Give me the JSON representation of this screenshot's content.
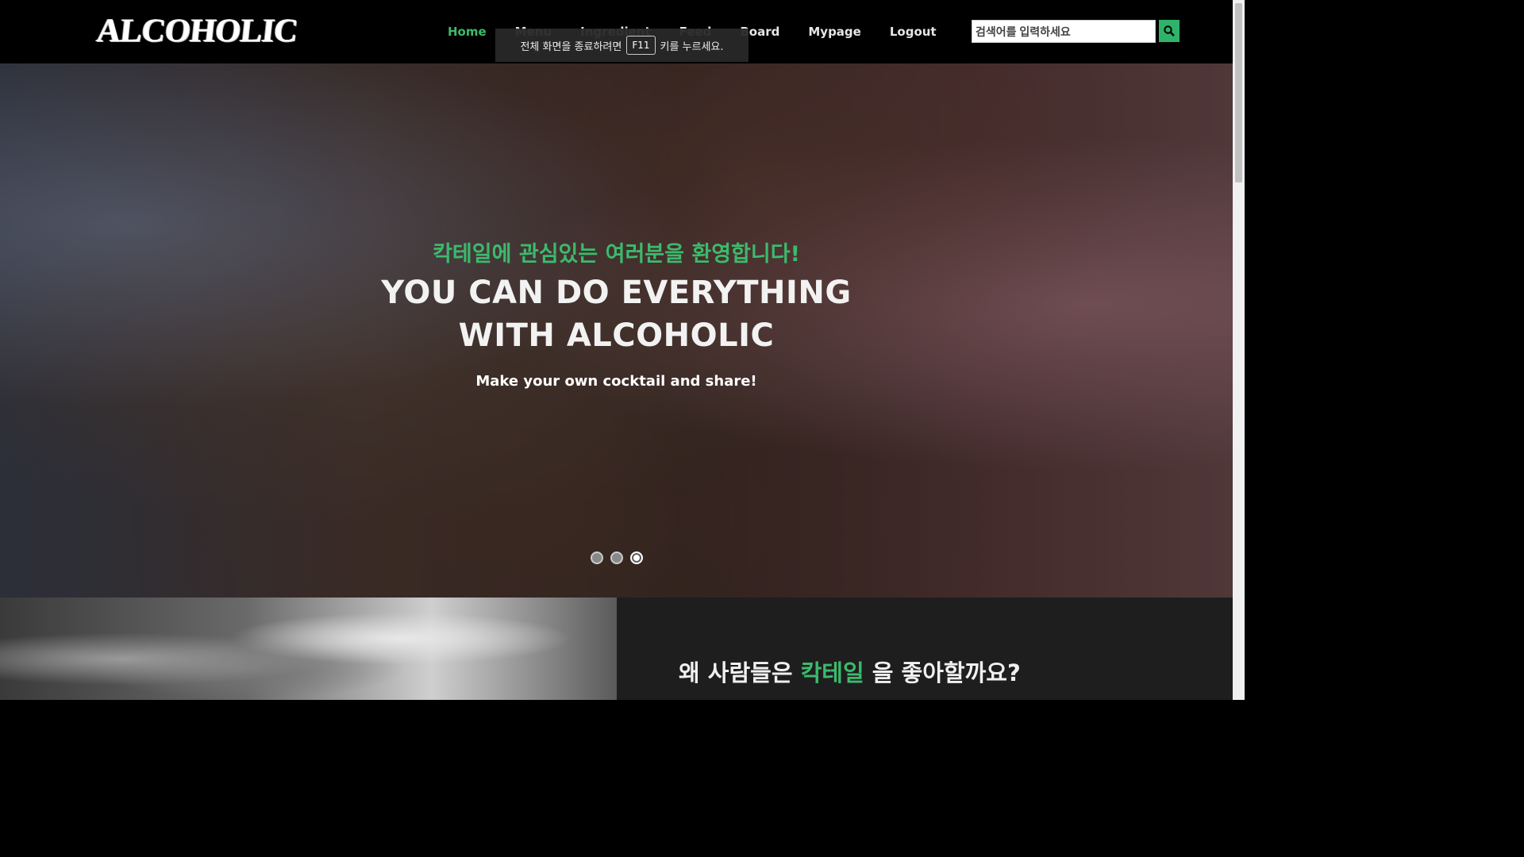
{
  "header": {
    "logo": "ALCOHOLIC",
    "nav": [
      {
        "label": "Home",
        "active": true
      },
      {
        "label": "Menu",
        "active": false
      },
      {
        "label": "Ingredient",
        "active": false
      },
      {
        "label": "Feed",
        "active": false
      },
      {
        "label": "Board",
        "active": false
      },
      {
        "label": "Mypage",
        "active": false
      },
      {
        "label": "Logout",
        "active": false
      }
    ],
    "search": {
      "placeholder": "검색어를 입력하세요",
      "value": ""
    }
  },
  "fullscreen_notice": {
    "before": "전체 화면을 종료하려면",
    "key": "F11",
    "after": "키를 누르세요."
  },
  "hero": {
    "welcome": "칵테일에 관심있는 여러분을 환영합니다!",
    "title_line1": "YOU CAN DO EVERYTHING",
    "title_line2": "WITH ALCOHOLIC",
    "subtitle": "Make your own cocktail and share!",
    "slides_total": 3,
    "active_slide": 3
  },
  "section": {
    "heading_pre": "왜 사람들은",
    "heading_accent": "칵테일",
    "heading_post": "을 좋아할까요?"
  },
  "colors": {
    "accent": "#3cba6c",
    "header_bg": "#000000",
    "section_bg": "#1e1e1f"
  }
}
